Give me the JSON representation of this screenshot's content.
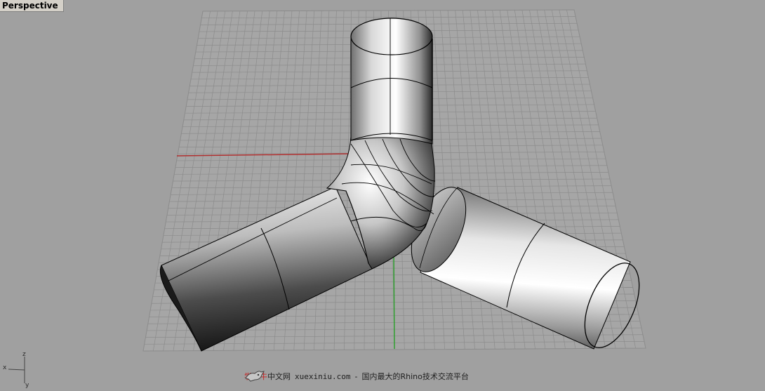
{
  "viewport": {
    "name": "Perspective"
  },
  "axis_icon": {
    "x": "x",
    "y": "y",
    "z": "z"
  },
  "watermark": {
    "brand": "学犀牛",
    "brand_suffix": "中文网",
    "url": "xuexiniu.com",
    "separator": "-",
    "tagline": "国内最大的Rhino技术交流平台"
  },
  "colors": {
    "grid_line": "#8c8c8c",
    "x_axis": "#b03030",
    "y_axis": "#30a030",
    "background": "#a0a0a0"
  }
}
